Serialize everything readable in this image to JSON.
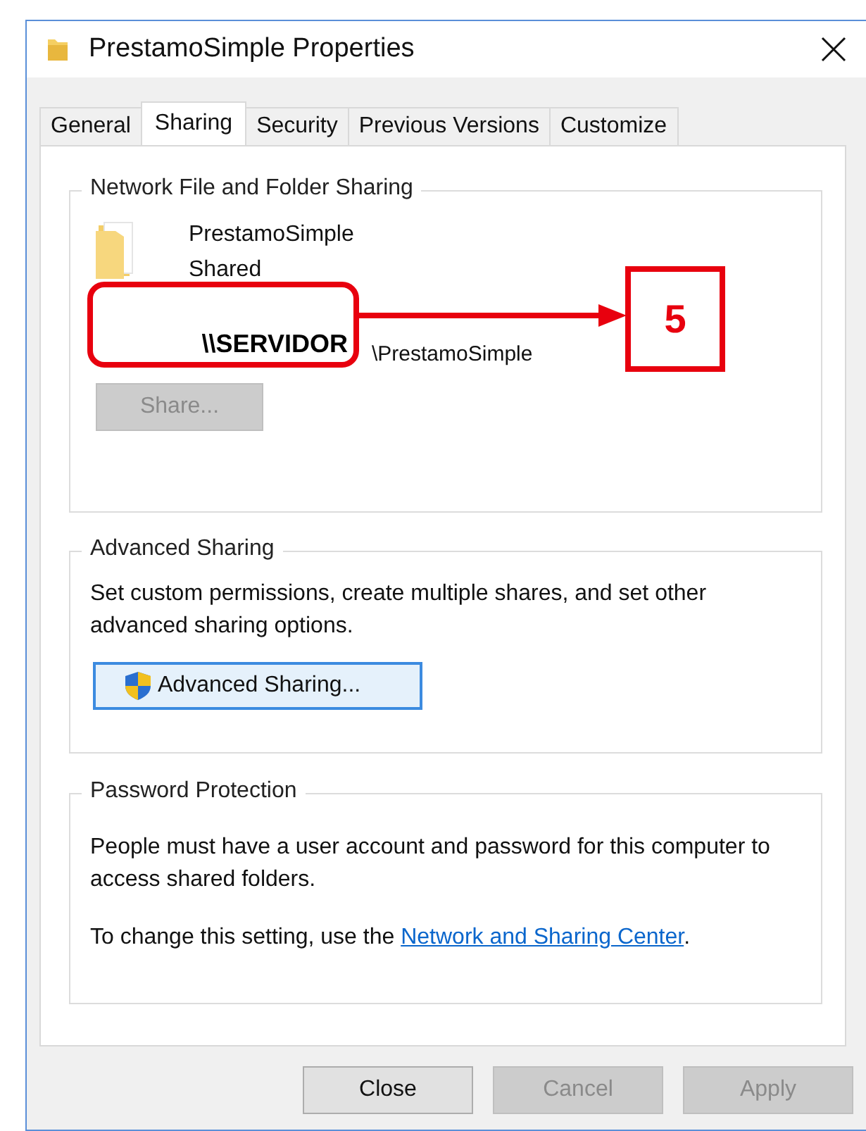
{
  "window": {
    "title": "PrestamoSimple Properties"
  },
  "tabs": [
    {
      "label": "General",
      "selected": false
    },
    {
      "label": "Sharing",
      "selected": true
    },
    {
      "label": "Security",
      "selected": false
    },
    {
      "label": "Previous Versions",
      "selected": false
    },
    {
      "label": "Customize",
      "selected": false
    }
  ],
  "network_sharing": {
    "title": "Network File and Folder Sharing",
    "folder_name": "PrestamoSimple",
    "status": "Shared",
    "path": "\\PrestamoSimple",
    "share_button": {
      "label": "Share...",
      "disabled": true
    }
  },
  "advanced_sharing": {
    "title": "Advanced Sharing",
    "description": "Set custom permissions, create multiple shares, and set other advanced sharing options.",
    "button": {
      "label": "Advanced Sharing..."
    }
  },
  "password_protection": {
    "title": "Password Protection",
    "description": "People must have a user account and password for this computer to access shared folders.",
    "hint": "To change this setting, use the ",
    "link": "Network and Sharing Center",
    "hint_end": "."
  },
  "buttons": [
    {
      "label": "Close",
      "disabled": false
    },
    {
      "label": "Cancel",
      "disabled": true
    },
    {
      "label": "Apply",
      "disabled": true
    }
  ],
  "annotation": {
    "overlay_text": "\\\\SERVIDOR",
    "callout": "5"
  }
}
